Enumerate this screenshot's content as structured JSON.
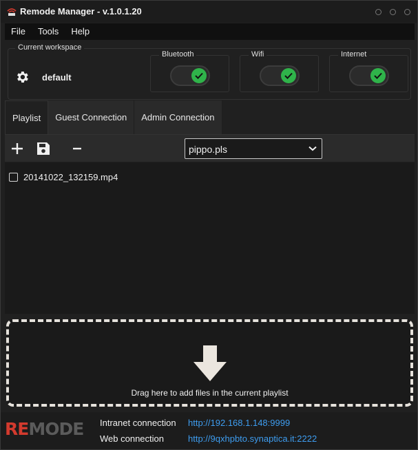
{
  "window": {
    "title": "Remode Manager - v.1.0.1.20"
  },
  "menu": {
    "items": [
      "File",
      "Tools",
      "Help"
    ]
  },
  "workspace": {
    "legend": "Current workspace",
    "name": "default",
    "toggles": [
      {
        "label": "Bluetooth",
        "on": true
      },
      {
        "label": "Wifi",
        "on": true
      },
      {
        "label": "Internet",
        "on": true
      }
    ]
  },
  "tabs": [
    {
      "label": "Playlist",
      "active": true
    },
    {
      "label": "Guest Connection",
      "active": false
    },
    {
      "label": "Admin Connection",
      "active": false
    }
  ],
  "toolbar": {
    "add_icon": "plus-icon",
    "save_icon": "save-icon",
    "remove_icon": "minus-icon",
    "playlist_select": "pippo.pls"
  },
  "playlist": {
    "items": [
      {
        "name": "20141022_132159.mp4",
        "checked": false
      }
    ]
  },
  "dropzone": {
    "text": "Drag here to add files in the current playlist",
    "icon": "down-arrow-icon"
  },
  "footer": {
    "logo_left": "RE",
    "logo_mid": "M",
    "logo_right": "ODE",
    "intranet_label": "Intranet connection",
    "intranet_url": "http://192.168.1.148:9999",
    "web_label": "Web connection",
    "web_url": "http://9qxhpbto.synaptica.it:2222"
  },
  "colors": {
    "accent_green": "#2fb34a",
    "link_blue": "#3e9df0",
    "logo_red": "#d33a2e"
  }
}
